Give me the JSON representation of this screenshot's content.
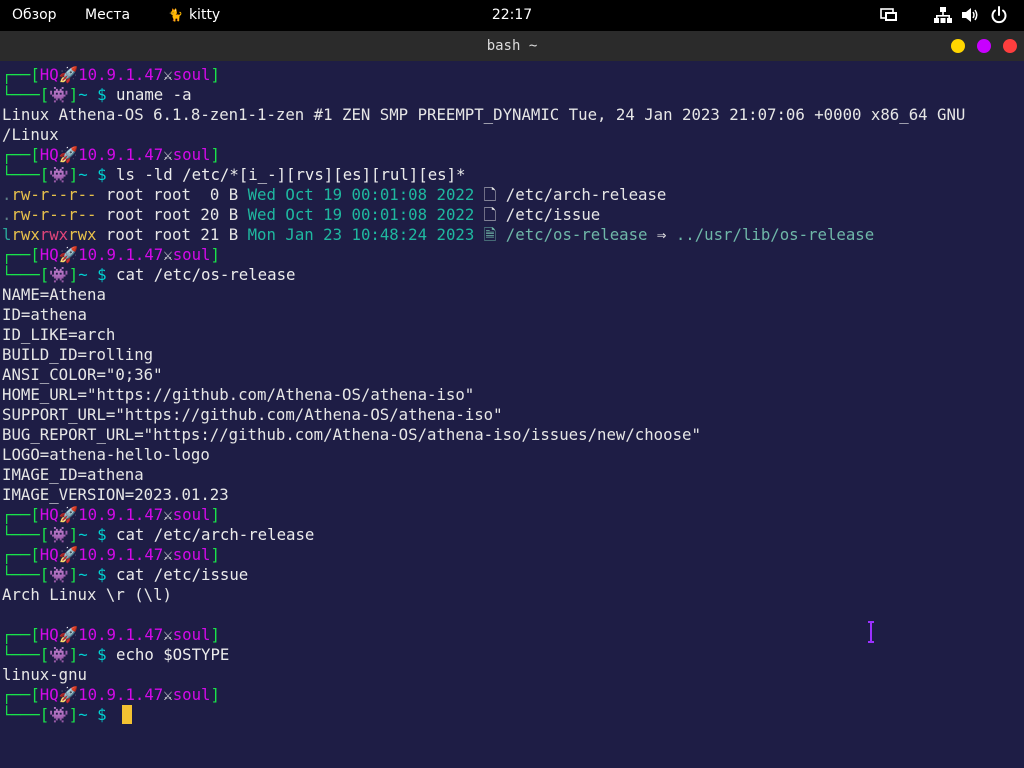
{
  "topbar": {
    "overview": "Обзор",
    "places": "Места",
    "app_icon": "cat-icon",
    "app_name": "kitty",
    "clock": "22:17",
    "tray_icons": [
      "screen-share-icon",
      "network-icon",
      "volume-icon",
      "power-icon"
    ]
  },
  "window": {
    "title": "bash ~",
    "buttons": [
      "minimize-button",
      "maximize-button",
      "close-button"
    ],
    "button_colors": [
      "#ffd600",
      "#c800ff",
      "#ff3e3e"
    ]
  },
  "prompt": {
    "top_prefix": "┌──[",
    "host": "HQ",
    "rocket": "🚀",
    "ip": "10.9.1.47",
    "swords": "⚔",
    "user": "soul",
    "close_bracket": "]",
    "bottom_prefix": "└───[",
    "alien": "👾",
    "dir_sign": "~ $ "
  },
  "commands": {
    "uname": "uname -a",
    "ls": "ls -ld /etc/*[i_-][rvs][es][rul][es]*",
    "cat_os": "cat /etc/os-release",
    "cat_arch": "cat /etc/arch-release",
    "cat_issue": "cat /etc/issue",
    "echo": "echo $OSTYPE"
  },
  "outputs": {
    "uname_1": "Linux Athena-OS 6.1.8-zen1-1-zen #1 ZEN SMP PREEMPT_DYNAMIC Tue, 24 Jan 2023 21:07:06 +0000 x86_64 GNU",
    "uname_2": "/Linux",
    "ls_rows": [
      {
        "perm": [
          ".",
          "rw-",
          "r--",
          "r--"
        ],
        "owner": " root root",
        "size": "  0 B",
        "date": " Wed Oct 19 00:01:08 2022 ",
        "icon": "🗋",
        "path": " /etc/arch-release",
        "arrow": "",
        "target": ""
      },
      {
        "perm": [
          ".",
          "rw-",
          "r--",
          "r--"
        ],
        "owner": " root root",
        "size": " 20 B",
        "date": " Wed Oct 19 00:01:08 2022 ",
        "icon": "🗋",
        "path": " /etc/issue",
        "arrow": "",
        "target": ""
      },
      {
        "perm": [
          "l",
          "rwx",
          "rwx",
          "rwx"
        ],
        "owner": " root root",
        "size": " 21 B",
        "date": " Mon Jan 23 10:48:24 2023 ",
        "icon": "🗎",
        "path": " /etc/os-release",
        "arrow": " ⇒ ",
        "target": "../usr/lib/os-release"
      }
    ],
    "os_release": [
      "NAME=Athena",
      "ID=athena",
      "ID_LIKE=arch",
      "BUILD_ID=rolling",
      "ANSI_COLOR=\"0;36\"",
      "HOME_URL=\"https://github.com/Athena-OS/athena-iso\"",
      "SUPPORT_URL=\"https://github.com/Athena-OS/athena-iso\"",
      "BUG_REPORT_URL=\"https://github.com/Athena-OS/athena-iso/issues/new/choose\"",
      "LOGO=athena-hello-logo",
      "IMAGE_ID=athena",
      "IMAGE_VERSION=2023.01.23"
    ],
    "issue": "Arch Linux \\r (\\l)",
    "ostype": "linux-gnu"
  },
  "colors": {
    "background": "#1e1d45",
    "prompt_frame": "#19e34a",
    "prompt_ip": "#d20ae8",
    "prompt_dir": "#00d2d2",
    "cursor": "#f3c232",
    "ibeam": "#9b30ff"
  }
}
